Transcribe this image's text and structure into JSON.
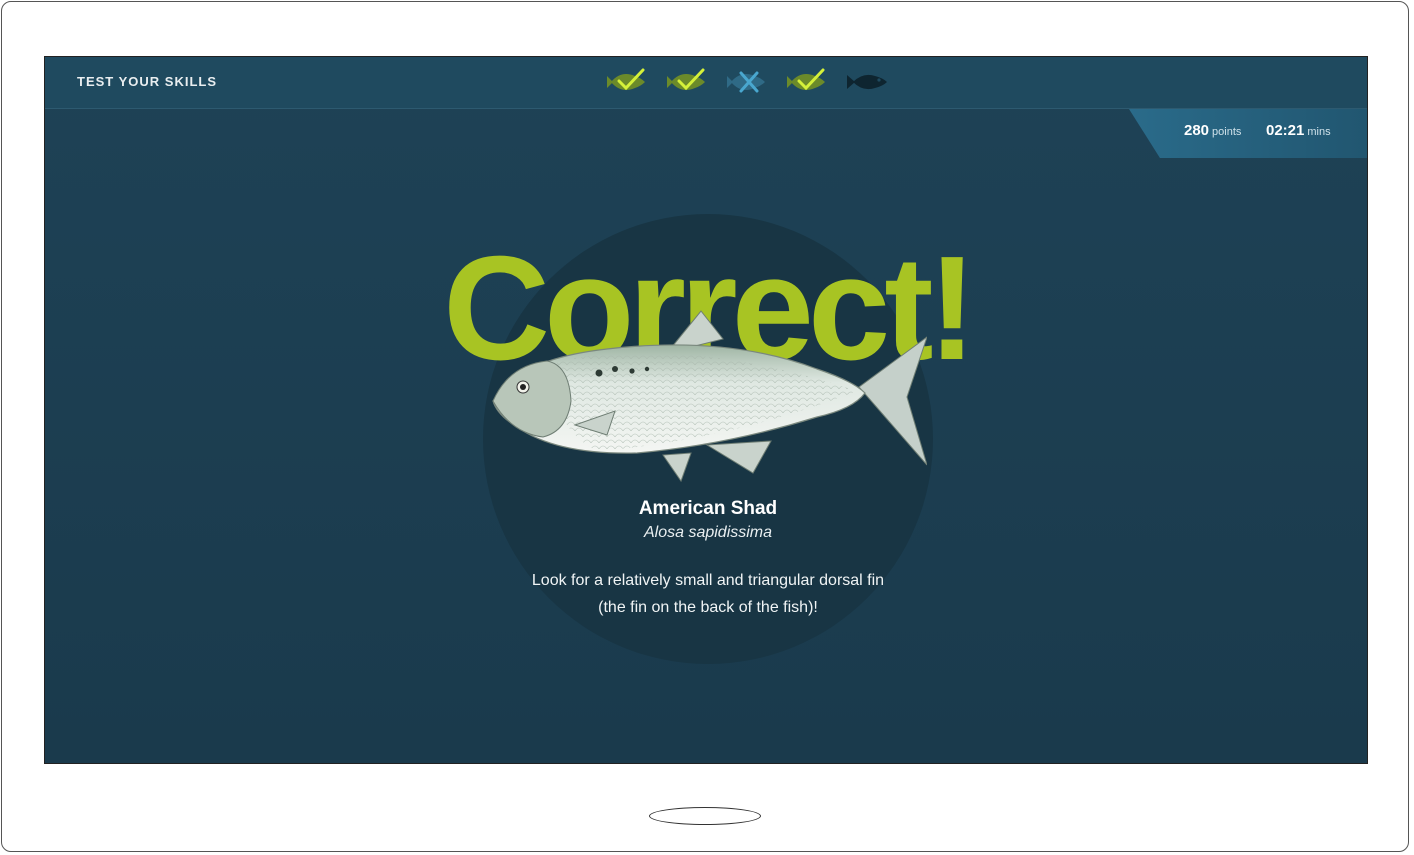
{
  "header": {
    "title": "TEST YOUR SKILLS"
  },
  "progress": {
    "items": [
      {
        "status": "correct",
        "icon": "fish-check-icon"
      },
      {
        "status": "correct",
        "icon": "fish-check-icon"
      },
      {
        "status": "incorrect",
        "icon": "fish-cross-icon"
      },
      {
        "status": "correct",
        "icon": "fish-check-icon"
      },
      {
        "status": "current",
        "icon": "fish-icon"
      }
    ]
  },
  "stats": {
    "points_value": "280",
    "points_unit": "points",
    "time_value": "02:21",
    "time_unit": "mins"
  },
  "result": {
    "headline": "Correct!",
    "fish_name": "American Shad",
    "fish_latin": "Alosa sapidissima",
    "hint_line1": "Look for a relatively small and triangular dorsal fin",
    "hint_line2": "(the fin on the back of the fish)!"
  },
  "colors": {
    "accent": "#a8c423",
    "background": "#1c3e51",
    "topbar": "#1f4a5f",
    "stats_panel": "#2a6b8a"
  }
}
